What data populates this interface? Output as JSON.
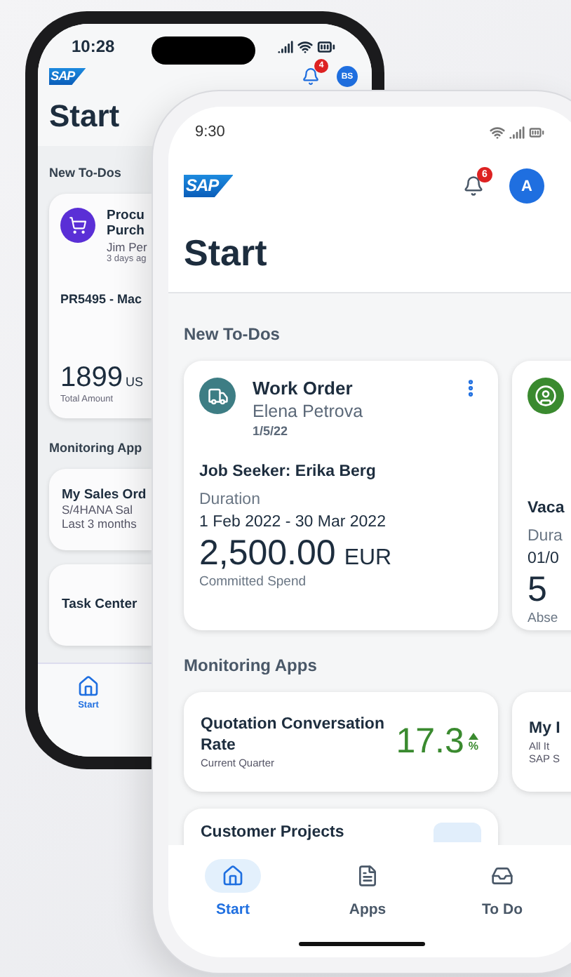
{
  "back_phone": {
    "status_time": "10:28",
    "logo": "SAP",
    "notification_count": "4",
    "avatar_initials": "BS",
    "title": "Start",
    "section_todos": "New To-Dos",
    "todo_card": {
      "title_lines": [
        "Procu",
        "Purch"
      ],
      "requester": "Jim Per",
      "age": "3 days ag",
      "item": "PR5495 - Mac",
      "amount": "1899",
      "currency": "US",
      "amount_label": "Total Amount"
    },
    "section_monitoring": "Monitoring App",
    "app_cards": [
      {
        "title": "My Sales Ord",
        "subtitle": "S/4HANA Sal",
        "detail": "Last 3 months"
      },
      {
        "title": "Task Center"
      }
    ],
    "tabs": [
      {
        "label": "Start",
        "selected": true
      }
    ]
  },
  "front_phone": {
    "status_time": "9:30",
    "logo": "SAP",
    "notification_count": "6",
    "avatar_initials": "A",
    "title": "Start",
    "section_todos": "New To-Dos",
    "todo_cards": [
      {
        "kind": "work_order",
        "color": "#3d7d84",
        "title": "Work Order",
        "person": "Elena Petrova",
        "date": "1/5/22",
        "subject": "Job Seeker: Erika Berg",
        "field_label": "Duration",
        "field_value": "1 Feb 2022 - 30 Mar 2022",
        "amount": "2,500.00",
        "unit": "EUR",
        "amount_label": "Committed Spend"
      },
      {
        "kind": "absence",
        "color": "#3a8a2f",
        "subject": "Vaca",
        "field_label": "Dura",
        "field_value": "01/0",
        "amount": "5",
        "amount_label": "Abse"
      }
    ],
    "section_monitoring": "Monitoring Apps",
    "app_cards": [
      {
        "kind": "kpi",
        "title": "Quotation Conversation Rate",
        "subtitle": "Current Quarter",
        "value": "17.3",
        "unit": "%"
      },
      {
        "kind": "list",
        "title": "My I",
        "subtitle": "All It",
        "detail": "SAP S"
      }
    ],
    "app_cards_row2": [
      {
        "kind": "chart",
        "title": "Customer Projects"
      }
    ],
    "tabs": [
      {
        "label": "Start",
        "selected": true
      },
      {
        "label": "Apps",
        "selected": false
      },
      {
        "label": "To Do",
        "selected": false
      }
    ]
  }
}
